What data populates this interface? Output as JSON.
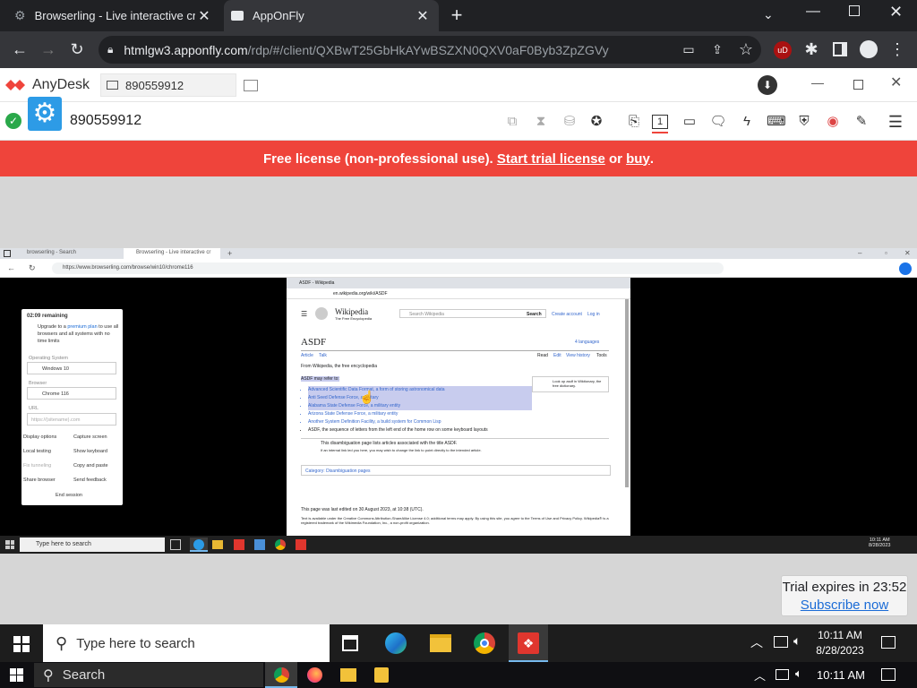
{
  "browser": {
    "tabs": [
      {
        "title": "Browserling - Live interactive cro"
      },
      {
        "title": "AppOnFly"
      }
    ],
    "url_host": "htmlgw3.apponfly.com",
    "url_path": "/rdp/#/client/QXBwT25GbHkAYwBSZXN0QXV0aF0Byb3ZpZGVy"
  },
  "anydesk": {
    "brand": "AnyDesk",
    "address_field": "890559912",
    "session_id": "890559912",
    "banner": {
      "prefix": "Free license (non-professional use). ",
      "link1": "Start trial license",
      "mid": " or ",
      "link2": "buy",
      "suffix": "."
    }
  },
  "remote": {
    "inner_tabs": [
      {
        "title": "browserling - Search"
      },
      {
        "title": "Browserling - Live interactive cr"
      }
    ],
    "inner_url": "https://www.browserling.com/browse/win10/chrome116",
    "panel": {
      "remaining": "02:09 remaining",
      "upgrade_text_1": "Upgrade to a ",
      "upgrade_link": "premium plan",
      "upgrade_text_2": " to use all browsers and all systems with no time limits",
      "os_label": "Operating System",
      "os_value": "Windows 10",
      "browser_label": "Browser",
      "browser_value": "Chrome 116",
      "url_label": "URL",
      "url_placeholder": "https://(sitename).com",
      "actions": [
        "Display options",
        "Capture screen",
        "Local testing",
        "Show keyboard",
        "Fix tunneling",
        "Copy and paste",
        "Share browser",
        "Send feedback"
      ],
      "end": "End session"
    },
    "wiki": {
      "tab_title": "ASDF - Wikipedia",
      "url": "en.wikipedia.org/wiki/ASDF",
      "logo_title": "Wikipedia",
      "logo_sub": "The Free Encyclopedia",
      "search_placeholder": "Search Wikipedia",
      "search_btn": "Search",
      "create_account": "Create account",
      "log_in": "Log in",
      "heading": "ASDF",
      "languages": "4 languages",
      "tab_article": "Article",
      "tab_talk": "Talk",
      "tab_read": "Read",
      "tab_edit": "Edit",
      "tab_history": "View history",
      "tab_tools": "Tools",
      "from": "From Wikipedia, the free encyclopedia",
      "intro": "ASDF may refer to:",
      "wiktionary": "Look up asdf in Wiktionary, the free dictionary.",
      "items": [
        "Advanced Scientific Data Format, a form of storing astronomical data",
        "Anti Seed Defense Force, a military",
        "Alabama State Defense Force, a military entity",
        "Arizona State Defense Force, a military entity",
        "Another System Definition Facility, a build system for Common Lisp",
        "ASDF, the sequence of letters from the left end of the home row on some keyboard layouts"
      ],
      "disambig_1": "This disambiguation page lists articles associated with the title ASDF.",
      "disambig_2": "If an internal link led you here, you may wish to change the link to point directly to the intended article.",
      "category": "Category: Disambiguation pages",
      "edited": "This page was last edited on 30 August 2023, at 10:38 (UTC).",
      "license": "Text is available under the Creative Commons Attribution-ShareAlike License 4.0; additional terms may apply. By using this site, you agree to the Terms of Use and Privacy Policy. Wikipedia® is a registered trademark of the Wikimedia Foundation, Inc., a non-profit organization."
    },
    "inner_taskbar": {
      "search": "Type here to search",
      "time": "10:11 AM",
      "date": "8/28/2023"
    }
  },
  "trial": {
    "text": "Trial expires in 23:52",
    "link": "Subscribe now"
  },
  "taskbar1": {
    "search": "Type here to search",
    "time": "10:11 AM",
    "date": "8/28/2023"
  },
  "taskbar2": {
    "search": "Search",
    "time": "10:11 AM"
  },
  "colors": {
    "anydesk_red": "#ef443b",
    "chrome_dark": "#202124"
  }
}
